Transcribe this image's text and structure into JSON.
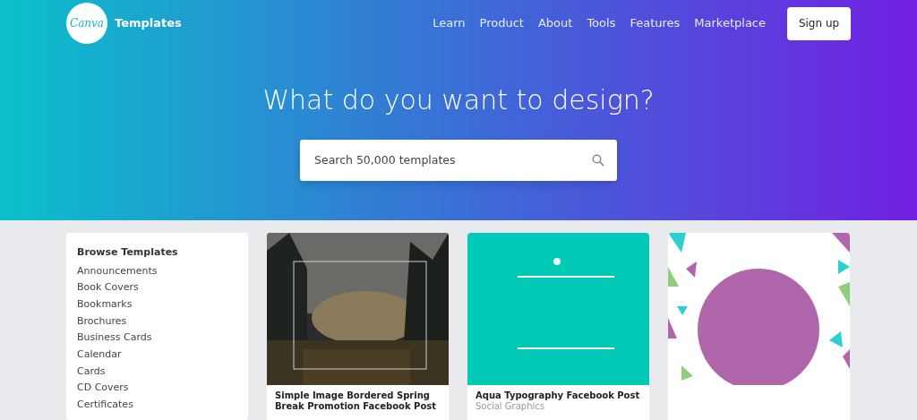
{
  "header": {
    "logo": "Canva",
    "title": "Templates",
    "nav": [
      {
        "label": "Learn"
      },
      {
        "label": "Product"
      },
      {
        "label": "About"
      },
      {
        "label": "Tools"
      },
      {
        "label": "Features"
      },
      {
        "label": "Marketplace"
      }
    ],
    "signup": "Sign up"
  },
  "hero": {
    "heading": "What do you want to design?",
    "search": {
      "placeholder": "Search 50,000 templates"
    }
  },
  "sidebar": {
    "title": "Browse Templates",
    "items": [
      {
        "label": "Announcements"
      },
      {
        "label": "Book Covers"
      },
      {
        "label": "Bookmarks"
      },
      {
        "label": "Brochures"
      },
      {
        "label": "Business Cards"
      },
      {
        "label": "Calendar"
      },
      {
        "label": "Cards"
      },
      {
        "label": "CD Covers"
      },
      {
        "label": "Certificates"
      }
    ]
  },
  "templates": [
    {
      "kind": "picture",
      "title": "Simple Image Bordered Spring Break Promotion Facebook Post"
    },
    {
      "kind": "picture",
      "title": "Aqua Typography Facebook Post",
      "category": "Social Graphics"
    },
    {
      "kind": "picture"
    }
  ]
}
